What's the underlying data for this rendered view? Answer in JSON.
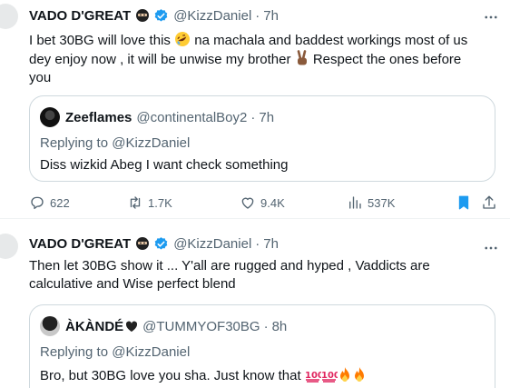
{
  "colors": {
    "text": "#0f1419",
    "secondary": "#536471",
    "verified": "#1d9bf0",
    "border": "#cfd9de",
    "fire": "#ff7a00",
    "hundred": "#e0245e"
  },
  "tweets": [
    {
      "author": {
        "name": "VADO D'GREAT",
        "handle": "@KizzDaniel",
        "time": "7h",
        "badge_icon": "ninja-icon",
        "verified_icon": "verified-badge-icon"
      },
      "text": {
        "line1": "I bet 30BG will love this",
        "line1_emoji": "rolling-laughing-emoji",
        "line1_rest": " na machala and baddest workings most of us",
        "line2": "dey enjoy now , it will be unwise my brother",
        "line2_emoji": "victory-hand-emoji",
        "line2_rest": " Respect the ones before",
        "line3": "you"
      },
      "quote": {
        "author_name": "Zeeflames",
        "author_handle": "@continentalBoy2",
        "time": "7h",
        "replying_to": "Replying to @KizzDaniel",
        "text": "Diss wizkid Abeg I want check something"
      },
      "actions": {
        "replies": "622",
        "retweets": "1.7K",
        "likes": "9.4K",
        "views": "537K"
      }
    },
    {
      "author": {
        "name": "VADO D'GREAT",
        "handle": "@KizzDaniel",
        "time": "7h",
        "badge_icon": "ninja-icon",
        "verified_icon": "verified-badge-icon"
      },
      "text": {
        "line1": "Then let 30BG show it ... Y'all are rugged and hyped , Vaddicts are",
        "line2": "calculative and Wise perfect blend"
      },
      "quote": {
        "author_name": "ÀKÀNDÉ",
        "author_handle": "@TUMMYOF30BG",
        "time": "8h",
        "replying_to": "Replying to @KizzDaniel",
        "text": "Bro, but 30BG love you sha. Just know that",
        "trailing_emojis": [
          "hundred-points-emoji",
          "hundred-points-emoji",
          "fire-emoji",
          "fire-emoji"
        ]
      }
    }
  ]
}
